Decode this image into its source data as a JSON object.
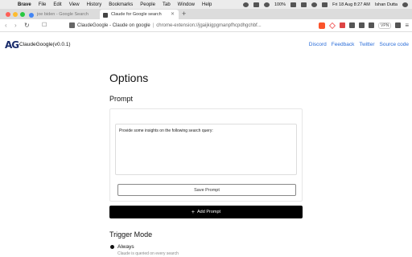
{
  "menubar": {
    "app": "Brave",
    "items": [
      "File",
      "Edit",
      "View",
      "History",
      "Bookmarks",
      "People",
      "Tab",
      "Window",
      "Help"
    ],
    "battery": "100%",
    "datetime": "Fri 18 Aug  8:27 AM",
    "user": "Ishan Dutta"
  },
  "tabs": [
    {
      "title": "joe biden - Google Search",
      "active": false
    },
    {
      "title": "Claude for Google search",
      "active": true
    }
  ],
  "toolbar": {
    "address_title": "ClaudeGoogle - Claude on google",
    "address_url": "chrome-extension://jgaijkigpgmanpfhcpdhgchbf...",
    "vpn_label": "VPN"
  },
  "header": {
    "logo_text": "AG",
    "brand": "ClaudeGoogle(v0.0.1)",
    "links": [
      "Discord",
      "Feedback",
      "Twitter",
      "Source code"
    ]
  },
  "main": {
    "title": "Options",
    "prompt_section": "Prompt",
    "prompt_text": "Provide some insights on the following search query:",
    "save_label": "Save Prompt",
    "add_label": "Add Prompt",
    "trigger_section": "Trigger Mode",
    "trigger_option": "Always",
    "trigger_desc": "Claude is queried on every search"
  }
}
